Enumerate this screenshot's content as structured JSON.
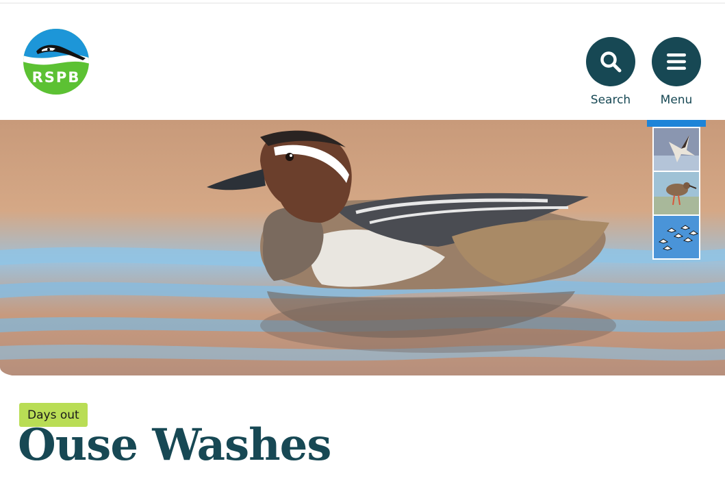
{
  "brand": {
    "logo_text": "RSPB"
  },
  "header": {
    "search_label": "Search",
    "menu_label": "Menu"
  },
  "hero": {
    "thumbnails": [
      {
        "name": "wader-bird-thumbnail"
      },
      {
        "name": "redshank-thumbnail"
      },
      {
        "name": "flock-in-flight-thumbnail"
      }
    ]
  },
  "main": {
    "tag": "Days out",
    "title": "Ouse Washes"
  },
  "colors": {
    "brand_dark": "#174854",
    "tag_green": "#b9dd55",
    "logo_blue": "#1d96d8",
    "logo_green": "#5cc133",
    "thumb_selected": "#1d84d8"
  }
}
